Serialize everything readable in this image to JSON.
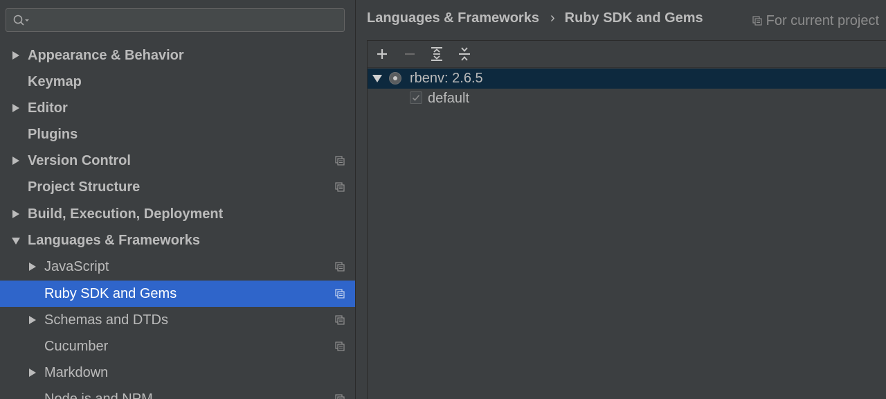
{
  "search": {
    "value": "",
    "placeholder": ""
  },
  "sidebar": {
    "items": [
      {
        "label": "Appearance & Behavior"
      },
      {
        "label": "Keymap"
      },
      {
        "label": "Editor"
      },
      {
        "label": "Plugins"
      },
      {
        "label": "Version Control"
      },
      {
        "label": "Project Structure"
      },
      {
        "label": "Build, Execution, Deployment"
      },
      {
        "label": "Languages & Frameworks"
      },
      {
        "label": "JavaScript"
      },
      {
        "label": "Ruby SDK and Gems"
      },
      {
        "label": "Schemas and DTDs"
      },
      {
        "label": "Cucumber"
      },
      {
        "label": "Markdown"
      },
      {
        "label": "Node.js and NPM"
      }
    ]
  },
  "breadcrumb": {
    "parent": "Languages & Frameworks",
    "separator": "›",
    "current": "Ruby SDK and Gems"
  },
  "scope_hint": "For current project",
  "sdk_tree": {
    "sdk_label": "rbenv: 2.6.5",
    "gemset_label": "default"
  },
  "colors": {
    "background": "#3c3f41",
    "selection": "#2f65ca",
    "sdk_row_highlight": "#0d293e",
    "text": "#bbbbbb"
  },
  "icons": {
    "search": "search-icon",
    "copy": "project-scope-icon",
    "add": "plus-icon",
    "remove": "minus-icon",
    "expand_all": "expand-all-icon",
    "collapse_all": "collapse-all-icon"
  }
}
